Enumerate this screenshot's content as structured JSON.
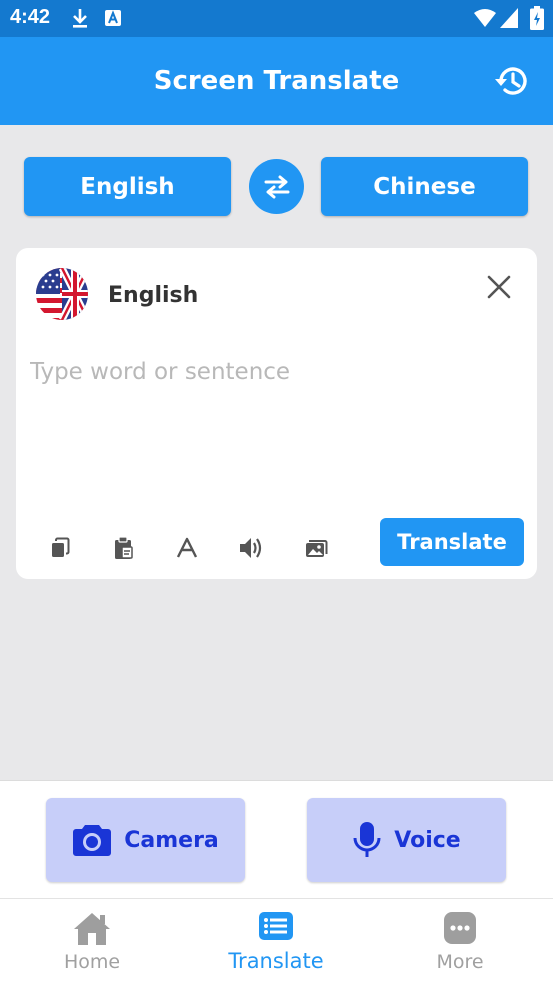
{
  "status_bar": {
    "time": "4:42",
    "icons": [
      "download-icon",
      "a-badge-icon",
      "wifi-icon",
      "signal-icon",
      "battery-icon"
    ]
  },
  "app_bar": {
    "title": "Screen Translate",
    "history_icon": "history-icon"
  },
  "languages": {
    "source": "English",
    "target": "Chinese",
    "swap_icon": "swap-icon"
  },
  "input_card": {
    "language": "English",
    "flag_icon": "us-uk-flag-icon",
    "value": "",
    "placeholder": "Type word or sentence",
    "tools": [
      "copy-icon",
      "paste-icon",
      "font-icon",
      "speaker-icon",
      "image-icon"
    ],
    "translate_label": "Translate"
  },
  "actions": {
    "camera_label": "Camera",
    "voice_label": "Voice"
  },
  "bottom_nav": {
    "items": [
      {
        "label": "Home",
        "icon": "home-icon",
        "active": false
      },
      {
        "label": "Translate",
        "icon": "translate-list-icon",
        "active": true
      },
      {
        "label": "More",
        "icon": "more-icon",
        "active": false
      }
    ]
  },
  "colors": {
    "primary": "#2196f3",
    "status_bar": "#1479cf",
    "action_bg": "#c7cef9",
    "action_text": "#1a35d6",
    "background": "#e8e8ea"
  }
}
